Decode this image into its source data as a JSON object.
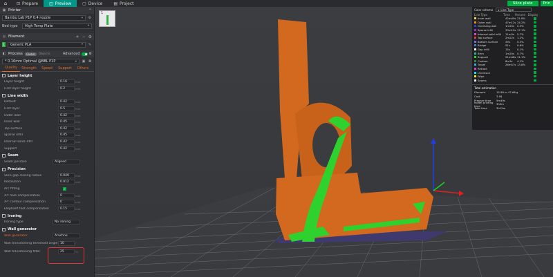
{
  "topbar": {
    "tabs": [
      {
        "label": "Prepare"
      },
      {
        "label": "Preview"
      },
      {
        "label": "Device"
      },
      {
        "label": "Project"
      }
    ],
    "slice_label": "Slice plate",
    "print_label": "Prin"
  },
  "sidebar": {
    "printer": {
      "title": "Printer",
      "value": "Bambu Lab P1P 0.4 nozzle",
      "bed_label": "Bed type",
      "bed_value": "High Temp Plate"
    },
    "filament": {
      "title": "Filament",
      "slot": "1",
      "value": "Generic PLA"
    },
    "process": {
      "title": "Process",
      "global": "Global",
      "object": "Objects",
      "advanced": "Advanced",
      "preset": "* 0.16mm Optimal @BBL P1P"
    },
    "tabs": [
      "Quality",
      "Strength",
      "Speed",
      "Support",
      "Others"
    ],
    "groups": {
      "layer_height": {
        "title": "Layer height",
        "rows": [
          {
            "label": "Layer height",
            "value": "0.16"
          },
          {
            "label": "First layer height",
            "value": "0.2"
          }
        ]
      },
      "line_width": {
        "title": "Line width",
        "rows": [
          {
            "label": "Default",
            "value": "0.42"
          },
          {
            "label": "First layer",
            "value": "0.5"
          },
          {
            "label": "Outer wall",
            "value": "0.42"
          },
          {
            "label": "Inner wall",
            "value": "0.45"
          },
          {
            "label": "Top surface",
            "value": "0.42"
          },
          {
            "label": "Sparse infill",
            "value": "0.45"
          },
          {
            "label": "Internal solid infill",
            "value": "0.42"
          },
          {
            "label": "Support",
            "value": "0.42"
          }
        ]
      },
      "seam": {
        "title": "Seam",
        "rows": [
          {
            "label": "Seam position",
            "value": "Aligned"
          }
        ]
      },
      "precision": {
        "title": "Precision",
        "rows": [
          {
            "label": "Slice gap closing radius",
            "value": "0.049"
          },
          {
            "label": "Resolution",
            "value": "0.012"
          },
          {
            "label": "Arc fitting",
            "value": ""
          },
          {
            "label": "X-Y hole compensation",
            "value": "0"
          },
          {
            "label": "X-Y contour compensation",
            "value": "0"
          },
          {
            "label": "Elephant foot compensation",
            "value": "0.15"
          }
        ]
      },
      "ironing": {
        "title": "Ironing",
        "rows": [
          {
            "label": "Ironing type",
            "value": "No ironing"
          }
        ]
      },
      "wall_generator": {
        "title": "Wall generator",
        "rows": [
          {
            "label": "Wall generator",
            "value": "Arachne"
          },
          {
            "label": "Wall transitioning threshold angle",
            "value": "10"
          },
          {
            "label": "Wall transitioning filter",
            "value": "25"
          }
        ]
      }
    }
  },
  "legend": {
    "scheme_label": "Color scheme",
    "scheme_value": "Line Type",
    "headers": {
      "type": "Line Type",
      "time": "Time",
      "percent": "Percent",
      "display": "Display"
    },
    "rows": [
      {
        "name": "Inner wall",
        "time": "42m40s",
        "pct": "21.8%",
        "color": "#f2d43d"
      },
      {
        "name": "Outer wall",
        "time": "47m12s",
        "pct": "24.2%",
        "color": "#f08a24"
      },
      {
        "name": "Overhang wall",
        "time": "1m20s",
        "pct": "0.5%",
        "color": "#2b3fd4"
      },
      {
        "name": "Sparse infill",
        "time": "33m19s",
        "pct": "17.1%",
        "color": "#9b2cbd"
      },
      {
        "name": "Internal solid infill",
        "time": "11m3s",
        "pct": "5.7%",
        "color": "#d44cc2"
      },
      {
        "name": "Top surface",
        "time": "2m22s",
        "pct": "1.2%",
        "color": "#e53b3b"
      },
      {
        "name": "Bottom surface",
        "time": "39s",
        "pct": "0.3%",
        "color": "#6b6bff"
      },
      {
        "name": "Bridge",
        "time": "51s",
        "pct": "0.6%",
        "color": "#4b78c8"
      },
      {
        "name": "Gap infill",
        "time": "15s",
        "pct": "0.1%",
        "color": "#ffffff"
      },
      {
        "name": "Brim",
        "time": "1m20s",
        "pct": "0.7%",
        "color": "#28b89c"
      },
      {
        "name": "Support",
        "time": "21m46s",
        "pct": "11.1%",
        "color": "#2fd12f"
      },
      {
        "name": "Custom",
        "time": "8m3s",
        "pct": "4.1%",
        "color": "#2d8c2d"
      },
      {
        "name": "Travel",
        "time": "26m57s",
        "pct": "13.8%",
        "color": "#2bb5e8"
      },
      {
        "name": "Retract",
        "time": "",
        "pct": "",
        "color": "#d63bd6"
      },
      {
        "name": "Unretract",
        "time": "",
        "pct": "",
        "color": "#00e5ff"
      },
      {
        "name": "Wipe",
        "time": "",
        "pct": "",
        "color": "#f2e033"
      },
      {
        "name": "Seams",
        "time": "",
        "pct": "",
        "color": "#e8e8e8"
      }
    ],
    "estimation": {
      "title": "Total estimation",
      "rows": [
        {
          "k": "Filament",
          "v": "15.98 m    47.66 g"
        },
        {
          "k": "Cost",
          "v": "3.9$"
        },
        {
          "k": "Prepare time",
          "v": "5m49s"
        },
        {
          "k": "Model printing time",
          "v": "3h9m"
        },
        {
          "k": "Total time",
          "v": "3h15m"
        }
      ]
    }
  },
  "canvas": {
    "plate_number": "1"
  },
  "colors": {
    "accent": "#00ae42",
    "tab_active": "#009688",
    "model": "#d2691e",
    "support": "#2fd12f",
    "highlight": "#e0393a"
  }
}
